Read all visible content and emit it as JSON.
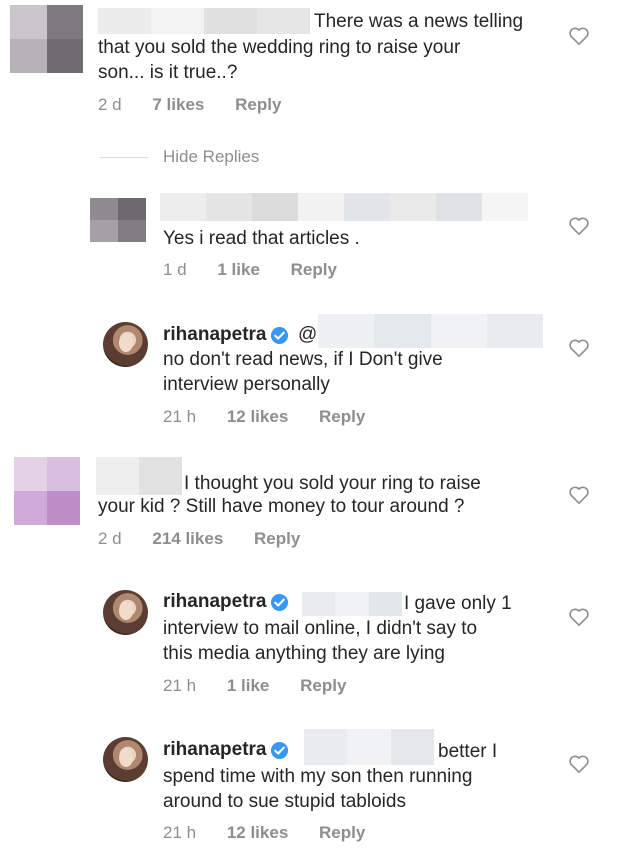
{
  "comments": [
    {
      "text_lines": [
        "There was a news telling",
        "that you sold the wedding ring to raise your",
        "son... is it true..?"
      ],
      "time": "2 d",
      "likes": "7 likes",
      "reply": "Reply"
    },
    {
      "hide_replies": "Hide Replies"
    },
    {
      "text_lines": [
        "Yes i read that articles ."
      ],
      "time": "1 d",
      "likes": "1 like",
      "reply": "Reply"
    },
    {
      "username": "rihanapetra",
      "mention_prefix": "@",
      "text_lines": [
        "no don't read news, if I Don't give",
        "interview personally"
      ],
      "time": "21 h",
      "likes": "12 likes",
      "reply": "Reply"
    },
    {
      "text_lines": [
        "I thought you sold your ring to raise",
        "your kid ? Still have money to tour around ?"
      ],
      "time": "2 d",
      "likes": "214 likes",
      "reply": "Reply"
    },
    {
      "username": "rihanapetra",
      "text_lines": [
        "I gave only 1",
        "interview to mail online, I didn't say to",
        "this media anything they are lying"
      ],
      "time": "21 h",
      "likes": "1 like",
      "reply": "Reply"
    },
    {
      "username": "rihanapetra",
      "text_lines": [
        "better I",
        "spend time with my son then running",
        "around to sue stupid  tabloids"
      ],
      "time": "21 h",
      "likes": "12 likes",
      "reply": "Reply"
    }
  ],
  "colors": {
    "text": "#262626",
    "meta": "#8e8e8e",
    "verified": "#3897f0",
    "divider": "#dbdbdb"
  },
  "icons": [
    "heart-icon",
    "verified-badge-icon"
  ]
}
